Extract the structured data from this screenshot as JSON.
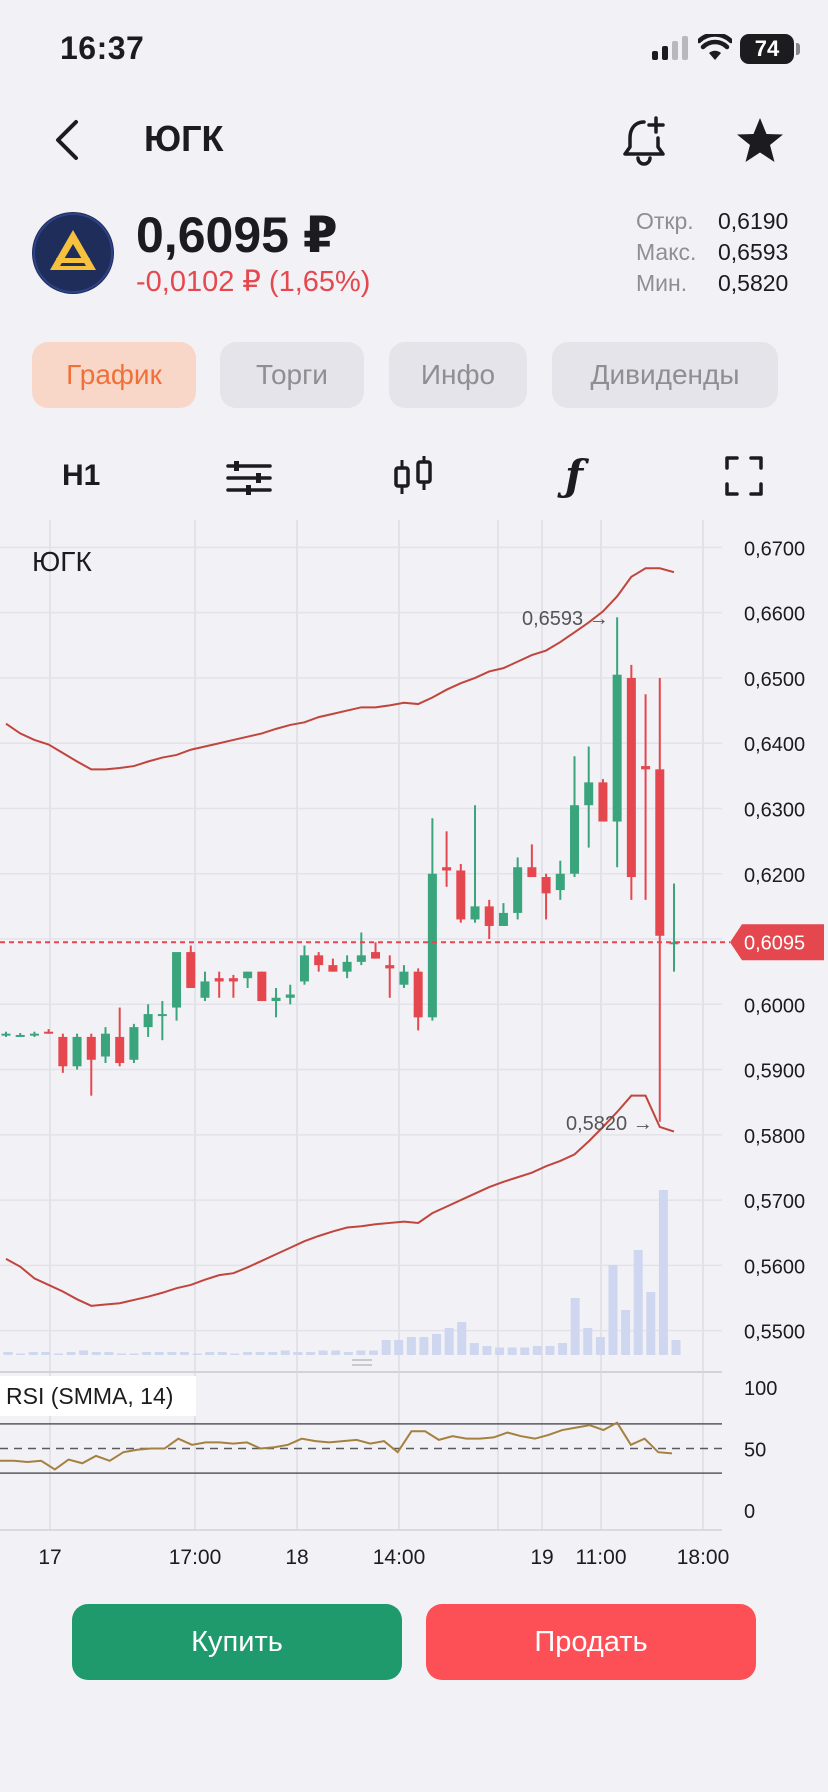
{
  "status": {
    "time": "16:37",
    "battery": "74"
  },
  "header": {
    "title": "ЮГК"
  },
  "quote": {
    "price": "0,6095 ₽",
    "change": "-0,0102 ₽ (1,65%)",
    "stats": [
      {
        "label": "Откр.",
        "value": "0,6190"
      },
      {
        "label": "Макс.",
        "value": "0,6593"
      },
      {
        "label": "Мин.",
        "value": "0,5820"
      }
    ]
  },
  "tabs": [
    {
      "label": "График",
      "active": true
    },
    {
      "label": "Торги",
      "active": false
    },
    {
      "label": "Инфо",
      "active": false
    },
    {
      "label": "Дивиденды",
      "active": false
    }
  ],
  "toolbar": {
    "interval": "H1",
    "icons": [
      "settings-sliders-icon",
      "candles-icon",
      "function-icon",
      "fullscreen-icon"
    ]
  },
  "chart_data": {
    "type": "candlestick",
    "title": "ЮГК",
    "ylim": [
      0.5455,
      0.6742
    ],
    "y_ticks": [
      "0,6700",
      "0,6600",
      "0,6500",
      "0,6400",
      "0,6300",
      "0,6200",
      "0,6100",
      "0,6000",
      "0,5900",
      "0,5800",
      "0,5700",
      "0,5600",
      "0,5500"
    ],
    "x_ticks": [
      "17",
      "17:00",
      "18",
      "14:00",
      "19",
      "11:00",
      "18:00"
    ],
    "last_price": 0.6095,
    "last_price_label": "0,6095",
    "high_label": "0,6593",
    "low_label": "0,5820",
    "candles": [
      [
        0.5955,
        0.5958,
        0.595,
        0.5955
      ],
      [
        0.5953,
        0.5956,
        0.595,
        0.5953
      ],
      [
        0.5955,
        0.5958,
        0.595,
        0.5955
      ],
      [
        0.5958,
        0.5962,
        0.5955,
        0.5955
      ],
      [
        0.595,
        0.5955,
        0.5895,
        0.5905
      ],
      [
        0.5905,
        0.5955,
        0.59,
        0.595
      ],
      [
        0.595,
        0.5955,
        0.586,
        0.5915
      ],
      [
        0.592,
        0.5965,
        0.591,
        0.5955
      ],
      [
        0.595,
        0.5995,
        0.5905,
        0.591
      ],
      [
        0.5915,
        0.597,
        0.591,
        0.5965
      ],
      [
        0.5965,
        0.6,
        0.595,
        0.5985
      ],
      [
        0.5985,
        0.6005,
        0.5945,
        0.5985
      ],
      [
        0.5995,
        0.6075,
        0.5975,
        0.608
      ],
      [
        0.608,
        0.609,
        0.6025,
        0.6025
      ],
      [
        0.601,
        0.605,
        0.6005,
        0.6035
      ],
      [
        0.604,
        0.605,
        0.601,
        0.6035
      ],
      [
        0.604,
        0.6045,
        0.601,
        0.6035
      ],
      [
        0.604,
        0.605,
        0.6025,
        0.605
      ],
      [
        0.605,
        0.605,
        0.6005,
        0.6005
      ],
      [
        0.6005,
        0.6025,
        0.598,
        0.601
      ],
      [
        0.601,
        0.603,
        0.6,
        0.6015
      ],
      [
        0.6035,
        0.609,
        0.603,
        0.6075
      ],
      [
        0.6075,
        0.608,
        0.605,
        0.606
      ],
      [
        0.606,
        0.607,
        0.605,
        0.605
      ],
      [
        0.605,
        0.6075,
        0.604,
        0.6065
      ],
      [
        0.6065,
        0.611,
        0.606,
        0.6075
      ],
      [
        0.608,
        0.6095,
        0.607,
        0.607
      ],
      [
        0.606,
        0.6075,
        0.601,
        0.6055
      ],
      [
        0.603,
        0.606,
        0.6025,
        0.605
      ],
      [
        0.605,
        0.6055,
        0.596,
        0.598
      ],
      [
        0.598,
        0.6285,
        0.5975,
        0.62
      ],
      [
        0.621,
        0.6265,
        0.618,
        0.6205
      ],
      [
        0.6205,
        0.6215,
        0.6125,
        0.613
      ],
      [
        0.613,
        0.6305,
        0.6125,
        0.615
      ],
      [
        0.615,
        0.616,
        0.61,
        0.612
      ],
      [
        0.612,
        0.6155,
        0.612,
        0.614
      ],
      [
        0.614,
        0.6225,
        0.613,
        0.621
      ],
      [
        0.621,
        0.6245,
        0.6195,
        0.6195
      ],
      [
        0.6195,
        0.62,
        0.613,
        0.617
      ],
      [
        0.6175,
        0.622,
        0.616,
        0.62
      ],
      [
        0.62,
        0.638,
        0.6195,
        0.6305
      ],
      [
        0.6305,
        0.6395,
        0.624,
        0.634
      ],
      [
        0.634,
        0.6345,
        0.629,
        0.628
      ],
      [
        0.628,
        0.6593,
        0.621,
        0.6505
      ],
      [
        0.65,
        0.652,
        0.616,
        0.6195
      ],
      [
        0.6365,
        0.6475,
        0.616,
        0.636
      ],
      [
        0.636,
        0.65,
        0.582,
        0.6105
      ],
      [
        0.6095,
        0.6185,
        0.605,
        0.6095
      ]
    ],
    "bb_upper": [
      0.643,
      0.6415,
      0.6405,
      0.6398,
      0.6385,
      0.6372,
      0.636,
      0.636,
      0.6362,
      0.6365,
      0.6372,
      0.6378,
      0.6382,
      0.639,
      0.6395,
      0.64,
      0.6405,
      0.641,
      0.6415,
      0.6422,
      0.6428,
      0.6432,
      0.644,
      0.6445,
      0.645,
      0.6455,
      0.6455,
      0.6458,
      0.6462,
      0.646,
      0.647,
      0.6482,
      0.6492,
      0.65,
      0.651,
      0.6515,
      0.6525,
      0.6535,
      0.6542,
      0.6555,
      0.657,
      0.6585,
      0.6602,
      0.6625,
      0.6655,
      0.6668,
      0.6668,
      0.6662
    ],
    "bb_lower": [
      0.561,
      0.5598,
      0.558,
      0.557,
      0.556,
      0.5548,
      0.5538,
      0.554,
      0.5542,
      0.5547,
      0.5552,
      0.5558,
      0.5565,
      0.557,
      0.5578,
      0.5585,
      0.5588,
      0.5597,
      0.5607,
      0.5617,
      0.5627,
      0.5637,
      0.5645,
      0.5652,
      0.5658,
      0.566,
      0.5663,
      0.5665,
      0.5667,
      0.5665,
      0.568,
      0.569,
      0.57,
      0.571,
      0.572,
      0.5728,
      0.5735,
      0.5742,
      0.5752,
      0.576,
      0.577,
      0.579,
      0.5812,
      0.5835,
      0.586,
      0.586,
      0.5812,
      0.5805
    ],
    "volumes": [
      2,
      1,
      2,
      2,
      1,
      2,
      3,
      2,
      2,
      1,
      1,
      2,
      2,
      2,
      2,
      1,
      2,
      2,
      1,
      2,
      2,
      2,
      3,
      2,
      2,
      3,
      3,
      2,
      3,
      3,
      10,
      10,
      12,
      12,
      14,
      18,
      22,
      8,
      6,
      5,
      5,
      5,
      6,
      6,
      8,
      38,
      18,
      12,
      60,
      30,
      70,
      42,
      110,
      10
    ],
    "rsi_label": "RSI (SMMA, 14)",
    "rsi_ticks": [
      "100",
      "50",
      "0"
    ],
    "rsi_bands": [
      70,
      30
    ],
    "rsi": [
      40,
      40,
      39,
      40,
      33,
      41,
      38,
      44,
      40,
      47,
      49,
      50,
      50,
      58,
      53,
      55,
      55,
      54,
      55,
      50,
      51,
      53,
      58,
      56,
      55,
      56,
      57,
      54,
      56,
      47,
      64,
      64,
      57,
      60,
      58,
      58,
      59,
      63,
      60,
      58,
      61,
      65,
      67,
      69,
      65,
      71,
      53,
      58,
      47,
      46
    ]
  },
  "actions": {
    "buy": "Купить",
    "sell": "Продать"
  }
}
